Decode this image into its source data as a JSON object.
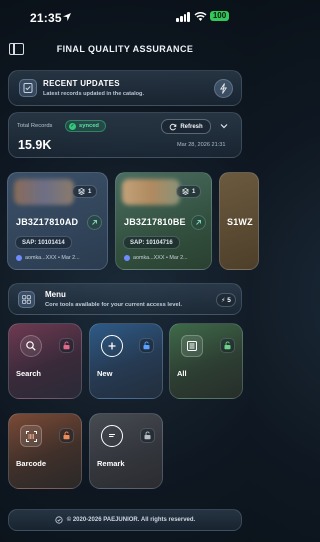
{
  "status_bar": {
    "time": "21:35",
    "battery": "100"
  },
  "header": {
    "title": "FINAL QUALITY ASSURANCE"
  },
  "recent_updates": {
    "title": "RECENT UPDATES",
    "subtitle": "Latest records updated in the catalog."
  },
  "records": {
    "label": "Total Records",
    "sync_status": "synced",
    "count": "15.9K",
    "refresh_label": "Refresh",
    "updated_at": "Mar 28, 2026 21:31"
  },
  "cards": [
    {
      "code": "JB3Z17810AD",
      "count": "1",
      "sap": "SAP: 10101414",
      "meta": "aomka...XXX • Mar 2..."
    },
    {
      "code": "JB3Z17810BE",
      "count": "1",
      "sap": "SAP: 10104716",
      "meta": "aomka...XXX • Mar 2..."
    },
    {
      "code": "S1WZ",
      "sap": "",
      "meta": ""
    }
  ],
  "menu": {
    "title": "Menu",
    "subtitle": "Core tools available for your current access level.",
    "count": "5"
  },
  "tiles": {
    "search": "Search",
    "new": "New",
    "all": "All",
    "barcode": "Barcode",
    "remark": "Remark"
  },
  "footer": {
    "text": "© 2020-2026 PAEJUNIOR. All rights reserved."
  },
  "colors": {
    "accent_green": "#34c77b",
    "tile_search": "#6e3a52",
    "tile_new": "#2e5a86",
    "tile_all": "#3f6a4a",
    "tile_barcode": "#7a4a36"
  }
}
